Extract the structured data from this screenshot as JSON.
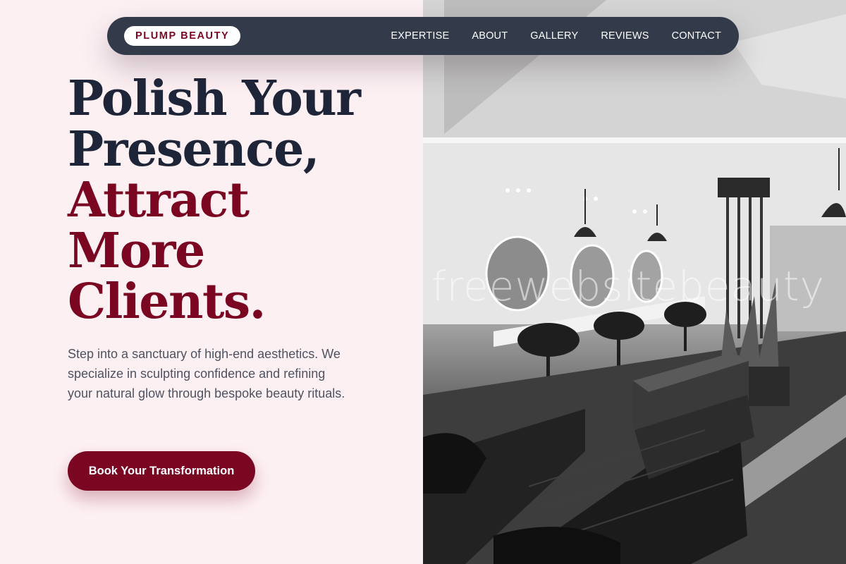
{
  "nav": {
    "brand": "PLUMP BEAUTY",
    "links": [
      "EXPERTISE",
      "ABOUT",
      "GALLERY",
      "REVIEWS",
      "CONTACT"
    ]
  },
  "hero": {
    "headline_line1": "Polish Your",
    "headline_line2": "Presence,",
    "headline_line3": "Attract",
    "headline_line4": "More",
    "headline_line5": "Clients.",
    "lead": "Step into a sanctuary of high-end aesthetics. We specialize in sculpting confidence and refining your natural glow through bespoke beauty rituals.",
    "cta_label": "Book Your Transformation"
  },
  "image": {
    "watermark": "freewebsitebeauty"
  },
  "colors": {
    "accent": "#7a0622",
    "dark": "#1e2538",
    "nav_bg": "#333b4a",
    "page_bg": "#fdf0f3"
  }
}
